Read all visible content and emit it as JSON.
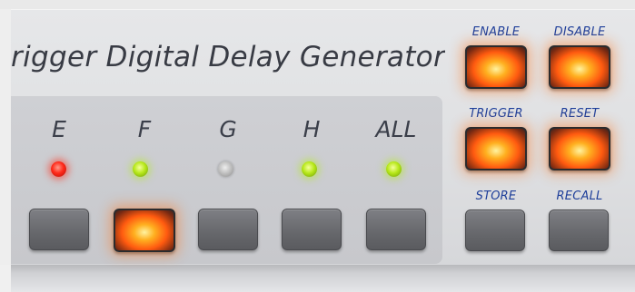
{
  "panel": {
    "title": "rigger Digital Delay Generator"
  },
  "channels": [
    {
      "label": "E",
      "led": "red",
      "key_lit": false
    },
    {
      "label": "F",
      "led": "green",
      "key_lit": true
    },
    {
      "label": "G",
      "led": "off",
      "key_lit": false
    },
    {
      "label": "H",
      "led": "green",
      "key_lit": false
    },
    {
      "label": "ALL",
      "led": "green",
      "key_lit": false
    }
  ],
  "function_keys": {
    "enable": {
      "label": "ENABLE",
      "lit": true
    },
    "disable": {
      "label": "DISABLE",
      "lit": true
    },
    "trigger": {
      "label": "TRIGGER",
      "lit": true
    },
    "reset": {
      "label": "RESET",
      "lit": true
    },
    "store": {
      "label": "STORE",
      "lit": false
    },
    "recall": {
      "label": "RECALL",
      "lit": false
    }
  },
  "colors": {
    "label_blue": "#1f3f9a",
    "led_red": "#ff2a1a",
    "led_green": "#b7e81a",
    "key_glow": "#ff7a18"
  }
}
